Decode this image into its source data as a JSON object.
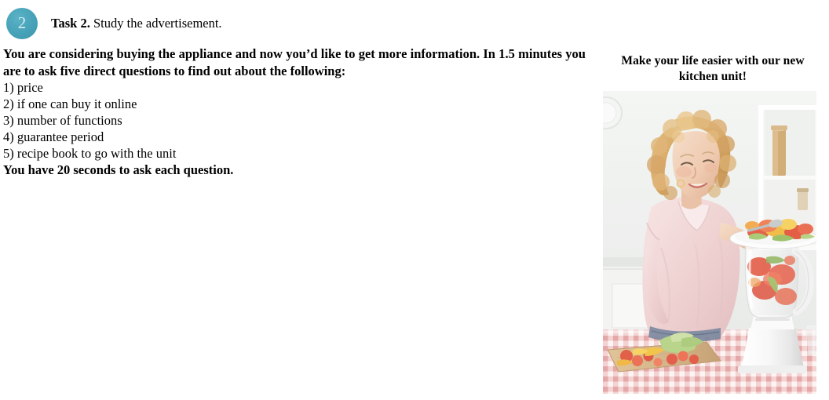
{
  "task": {
    "badge_number": "2",
    "label": "Task 2.",
    "description": "Study the advertisement.",
    "badge_color": "#46a2b8",
    "badge_number_color": "#d6ecf2"
  },
  "instructions": {
    "intro": "You are considering buying the appliance and now you’d like to get more information. In 1.5 minutes you are to ask five direct questions to find out about the following:",
    "points": [
      "1) price",
      "2) if one can buy it online",
      "3) number of functions",
      "4) guarantee period",
      "5) recipe book to go with the unit"
    ],
    "closing": "You have 20 seconds to ask each question."
  },
  "advertisement": {
    "heading": "Make your life easier with our new kitchen unit!",
    "photo": {
      "alt": "Young woman with curly blonde hair in a pink t-shirt adding chopped vegetables from a plate into a white blender on a kitchen table covered with a red and white gingham cloth",
      "colors": {
        "wall": "#eef0ee",
        "shelf": "#f8f8f6",
        "skin": "#efc9ae",
        "hair": "#d9a861",
        "shirt": "#f0d4d4",
        "jeans": "#5d6f8c",
        "blender": "#fbfbfb",
        "tablecloth_red": "#e9a8a8",
        "tablecloth_white": "#fbf3f3",
        "board": "#d9b98a",
        "tomato": "#e45540",
        "pepper_yellow": "#f2c53d",
        "lettuce": "#a9ca7a"
      }
    }
  }
}
